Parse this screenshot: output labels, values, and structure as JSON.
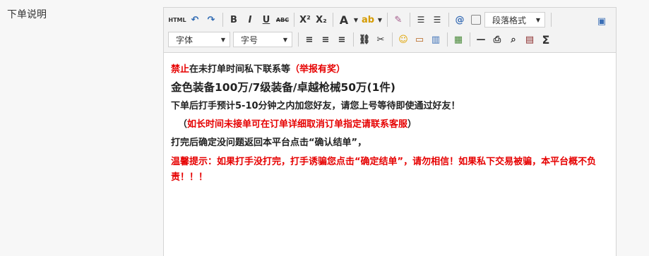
{
  "field": {
    "label": "下单说明"
  },
  "toolbar": {
    "html_label": "HTML",
    "bold_label": "B",
    "italic_label": "I",
    "underline_label": "U",
    "strike_label": "ABC",
    "sup_label": "X²",
    "sub_label": "X₂",
    "fontcolor_label": "A",
    "paragraph_format": "段落格式",
    "font_family": "字体",
    "font_size": "字号",
    "sigma_label": "Σ"
  },
  "content": {
    "line1_red": "禁止",
    "line1_text": "在未打单时间私下联系等",
    "line1_red2": "（举报有奖）",
    "line2": "金色装备100万/7级装备/卓越枪械50万(1件)",
    "line3": "下单后打手预计5-10分钟之内加您好友，请您上号等待即使通过好友！",
    "line4_open": "（",
    "line4_red": "如长时间未接单可在订单详细取消订单指定请联系客服",
    "line4_close": "）",
    "line5": "打完后确定没问题返回本平台点击“确认结单”，",
    "line6": "温馨提示：如果打手没打完，打手诱骗您点击“确定结单”，请勿相信！如果私下交易被骗，本平台概不负责！！！"
  },
  "colors": {
    "accent_red": "#e60000",
    "toolbar_bg": "#f3f3f3"
  }
}
